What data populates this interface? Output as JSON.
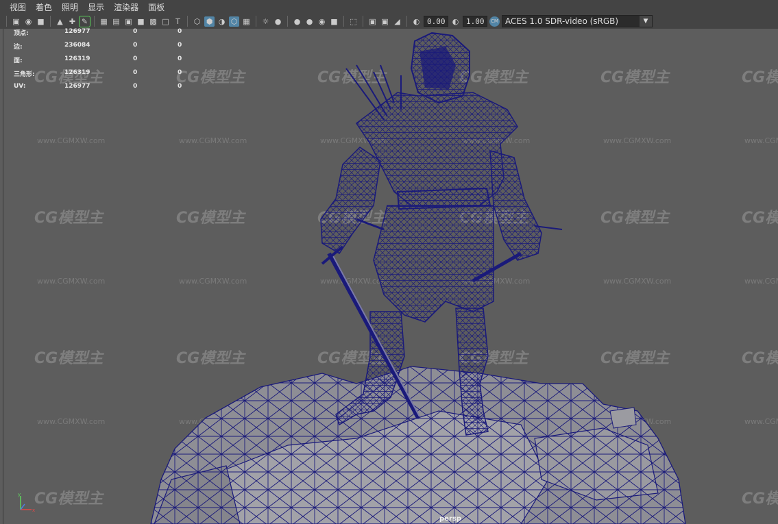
{
  "menu": [
    "视图",
    "着色",
    "照明",
    "显示",
    "渲染器",
    "面板"
  ],
  "toolbar": {
    "exposure_value": "0.00",
    "gamma_value": "1.00",
    "color_space": "ACES 1.0 SDR-video (sRGB)",
    "icons": [
      "camera-icon",
      "camera-attr-icon",
      "bookmark-icon",
      "image-plane-icon",
      "2d-pan-icon",
      "grease-pencil-icon",
      "grid-icon",
      "film-gate-icon",
      "resolution-gate-icon",
      "gate-mask-icon",
      "field-chart-icon",
      "safe-action-icon",
      "safe-title-icon",
      "wireframe-icon",
      "smooth-shade-icon",
      "default-material-icon",
      "wireframe-on-shaded-icon",
      "textured-icon",
      "use-lights-icon",
      "shadows-icon",
      "screen-space-ao-icon",
      "motion-blur-icon",
      "anti-aliasing-icon",
      "depth-of-field-icon",
      "isolate-select-icon",
      "xray-icon",
      "xray-joints-icon",
      "backface-culling-icon",
      "exposure-icon",
      "gamma-icon",
      "color-management-icon"
    ]
  },
  "hud": {
    "rows": [
      {
        "label": "顶点:",
        "v1": "126977",
        "v2": "0",
        "v3": "0"
      },
      {
        "label": "边:",
        "v1": "236084",
        "v2": "0",
        "v3": "0"
      },
      {
        "label": "面:",
        "v1": "126319",
        "v2": "0",
        "v3": "0"
      },
      {
        "label": "三角形:",
        "v1": "126319",
        "v2": "0",
        "v3": "0"
      },
      {
        "label": "UV:",
        "v1": "126977",
        "v2": "0",
        "v3": "0"
      }
    ]
  },
  "viewport": {
    "camera": "persp",
    "watermark": "CG模型主",
    "watermark_url": "www.CGMXW.com",
    "wire_color": "#1a1a7a",
    "background": "#5d5d5d"
  }
}
